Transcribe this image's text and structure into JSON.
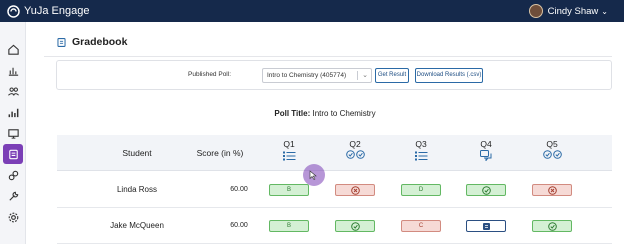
{
  "app": {
    "title": "YuJa Engage"
  },
  "user": {
    "name": "Cindy Shaw"
  },
  "sidebar": {
    "items": [
      {
        "icon": "home-icon",
        "active": false
      },
      {
        "icon": "bar-chart-icon",
        "active": false
      },
      {
        "icon": "people-icon",
        "active": false
      },
      {
        "icon": "analytics-icon",
        "active": false
      },
      {
        "icon": "presentation-icon",
        "active": false
      },
      {
        "icon": "gradebook-icon",
        "active": true
      },
      {
        "icon": "integrations-icon",
        "active": false
      },
      {
        "icon": "tools-icon",
        "active": false
      },
      {
        "icon": "settings-icon",
        "active": false
      }
    ]
  },
  "page": {
    "title": "Gradebook"
  },
  "filter": {
    "published_poll_label": "Published Poll:",
    "selected_poll": "Intro to Chemistry (405774)",
    "get_result": "Get Result",
    "download_results": "Download Results (.csv)"
  },
  "poll": {
    "title_label": "Poll Title:",
    "title_value": "Intro to Chemistry"
  },
  "table": {
    "headers": {
      "student": "Student",
      "score": "Score (in %)"
    },
    "questions": [
      {
        "label": "Q1",
        "icon": "list-icon"
      },
      {
        "label": "Q2",
        "icon": "multi-check-icon"
      },
      {
        "label": "Q3",
        "icon": "list-icon"
      },
      {
        "label": "Q4",
        "icon": "chat-icon"
      },
      {
        "label": "Q5",
        "icon": "multi-check-icon"
      }
    ],
    "rows": [
      {
        "student": "Linda Ross",
        "score": "60.00",
        "answers": [
          {
            "type": "text",
            "value": "B",
            "status": "correct"
          },
          {
            "type": "icon",
            "icon": "cross-icon",
            "status": "wrong"
          },
          {
            "type": "text",
            "value": "D",
            "status": "correct"
          },
          {
            "type": "icon",
            "icon": "check-icon",
            "status": "correct"
          },
          {
            "type": "icon",
            "icon": "cross-icon",
            "status": "wrong"
          }
        ]
      },
      {
        "student": "Jake McQueen",
        "score": "60.00",
        "answers": [
          {
            "type": "text",
            "value": "B",
            "status": "correct"
          },
          {
            "type": "icon",
            "icon": "check-icon",
            "status": "correct"
          },
          {
            "type": "text",
            "value": "C",
            "status": "wrong"
          },
          {
            "type": "icon",
            "icon": "document-icon",
            "status": "neutral"
          },
          {
            "type": "icon",
            "icon": "check-icon",
            "status": "correct"
          }
        ]
      }
    ]
  },
  "colors": {
    "topbar": "#15294b",
    "accent": "#7b3fb6",
    "correct": "#63b863",
    "wrong": "#d28b80",
    "link": "#2b6aa6"
  }
}
